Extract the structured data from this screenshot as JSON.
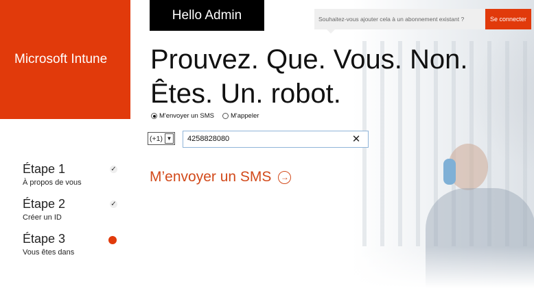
{
  "brand": {
    "name": "Microsoft Intune",
    "color": "#e13a0b"
  },
  "header": {
    "greeting": "Hello Admin",
    "signin_prompt": "Souhaitez-vous ajouter cela à un abonnement existant ?",
    "signin_button": "Se connecter"
  },
  "headline": {
    "line1": "Prouvez. Que. Vous. Non.",
    "line2": "Êtes. Un. robot."
  },
  "verification": {
    "options": [
      {
        "label": "M'envoyer un SMS",
        "selected": true
      },
      {
        "label": "M'appeler",
        "selected": false
      }
    ],
    "country_code": "(+1)",
    "phone_value": "4258828080",
    "submit_label": "M’envoyer un SMS"
  },
  "steps": [
    {
      "title": "Étape 1",
      "subtitle": "À propos de vous",
      "status": "done"
    },
    {
      "title": "Étape 2",
      "subtitle": "Créer un ID",
      "status": "done"
    },
    {
      "title": "Étape 3",
      "subtitle": "Vous êtes dans",
      "status": "current"
    }
  ],
  "icons": {
    "step_done": "check-icon",
    "step_current": "current-dot-icon",
    "clear": "close-icon",
    "submit": "arrow-right-circle-icon"
  }
}
